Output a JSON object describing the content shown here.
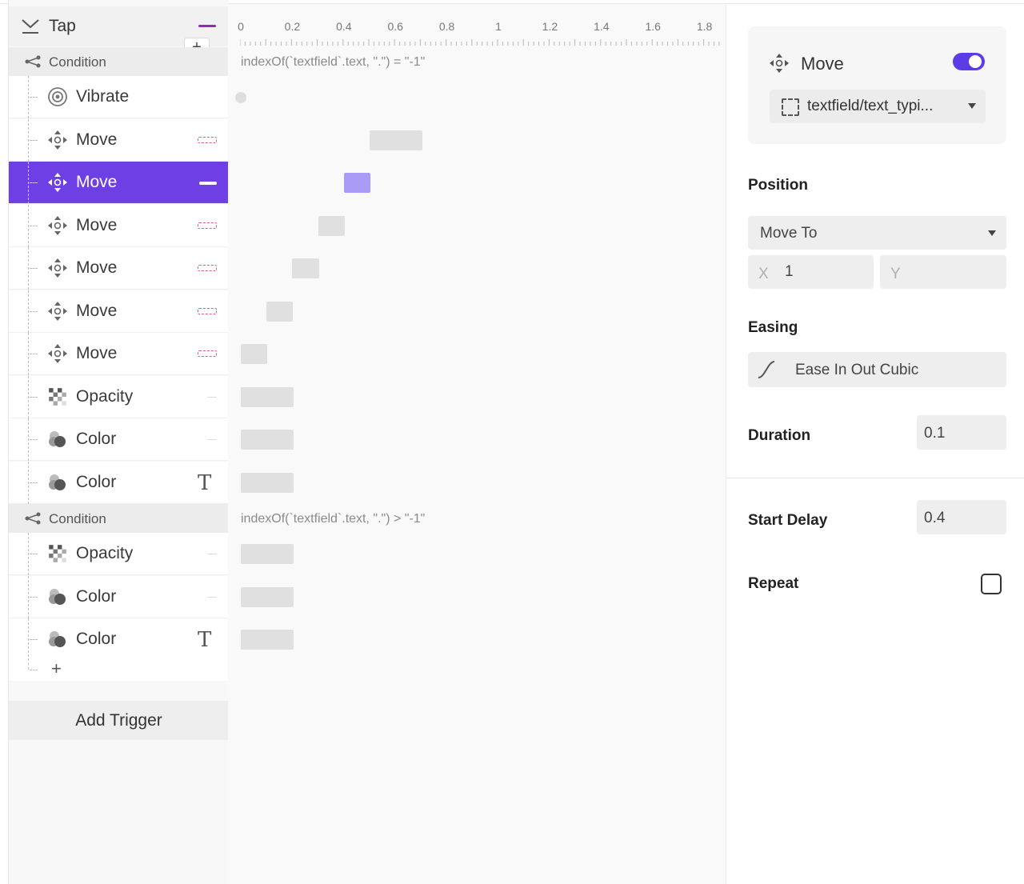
{
  "tree": {
    "trigger_label": "Tap",
    "add_plus": "+",
    "conditions": [
      {
        "label": "Condition",
        "expression": "indexOf(`textfield`.text, \".\") = \"-1\"",
        "actions": [
          {
            "label": "Vibrate",
            "icon": "vibrate-icon",
            "marker": "none"
          },
          {
            "label": "Move",
            "icon": "move-icon",
            "marker": "ease"
          },
          {
            "label": "Move",
            "icon": "move-icon",
            "marker": "ease",
            "selected": true
          },
          {
            "label": "Move",
            "icon": "move-icon",
            "marker": "ease"
          },
          {
            "label": "Move",
            "icon": "move-icon",
            "marker": "ease"
          },
          {
            "label": "Move",
            "icon": "move-icon",
            "marker": "ease"
          },
          {
            "label": "Move",
            "icon": "move-icon",
            "marker": "ease"
          },
          {
            "label": "Opacity",
            "icon": "opacity-icon",
            "marker": "dash"
          },
          {
            "label": "Color",
            "icon": "color-icon",
            "marker": "dash"
          },
          {
            "label": "Color",
            "icon": "color-icon",
            "marker": "text",
            "marker_text": "T"
          }
        ]
      },
      {
        "label": "Condition",
        "expression": "indexOf(`textfield`.text, \".\") > \"-1\"",
        "actions": [
          {
            "label": "Opacity",
            "icon": "opacity-icon",
            "marker": "dash"
          },
          {
            "label": "Color",
            "icon": "color-icon",
            "marker": "dash"
          },
          {
            "label": "Color",
            "icon": "color-icon",
            "marker": "text",
            "marker_text": "T"
          }
        ]
      }
    ],
    "add_action": "+",
    "add_trigger": "Add Trigger"
  },
  "timeline": {
    "ruler_labels": [
      "0",
      "0.2",
      "0.4",
      "0.6",
      "0.8",
      "1",
      "1.2",
      "1.4",
      "1.6",
      "1.8"
    ],
    "blocks": [
      {
        "start": 0.0,
        "duration": 0.0,
        "kind": "dot"
      },
      {
        "start": 0.5,
        "duration": 0.2,
        "kind": "bar"
      },
      {
        "start": 0.4,
        "duration": 0.1,
        "kind": "bar",
        "selected": true
      },
      {
        "start": 0.3,
        "duration": 0.1,
        "kind": "bar"
      },
      {
        "start": 0.2,
        "duration": 0.1,
        "kind": "bar"
      },
      {
        "start": 0.1,
        "duration": 0.1,
        "kind": "bar"
      },
      {
        "start": 0.0,
        "duration": 0.1,
        "kind": "bar"
      },
      {
        "start": 0.0,
        "duration": 0.2,
        "kind": "bar"
      },
      {
        "start": 0.0,
        "duration": 0.2,
        "kind": "bar"
      },
      {
        "start": 0.0,
        "duration": 0.2,
        "kind": "bar"
      },
      {
        "start": 0.0,
        "duration": 0.2,
        "kind": "bar"
      },
      {
        "start": 0.0,
        "duration": 0.2,
        "kind": "bar"
      },
      {
        "start": 0.0,
        "duration": 0.2,
        "kind": "bar"
      }
    ]
  },
  "inspector": {
    "action_label": "Move",
    "enabled": true,
    "target": "textfield/text_typi...",
    "position_label": "Position",
    "position_mode": "Move To",
    "x_label": "X",
    "x_value": "1",
    "y_label": "Y",
    "y_value": "",
    "easing_label": "Easing",
    "easing_value": "Ease In Out Cubic",
    "duration_label": "Duration",
    "duration_value": "0.1",
    "start_delay_label": "Start Delay",
    "start_delay_value": "0.4",
    "repeat_label": "Repeat",
    "repeat_checked": false
  },
  "colors": {
    "accent": "#6f3fe6",
    "toggle": "#5b3ce6",
    "selected_bar": "#a99bf6",
    "trigger_mark": "#8c2bb8",
    "ease_mark": "#e05a8a"
  }
}
